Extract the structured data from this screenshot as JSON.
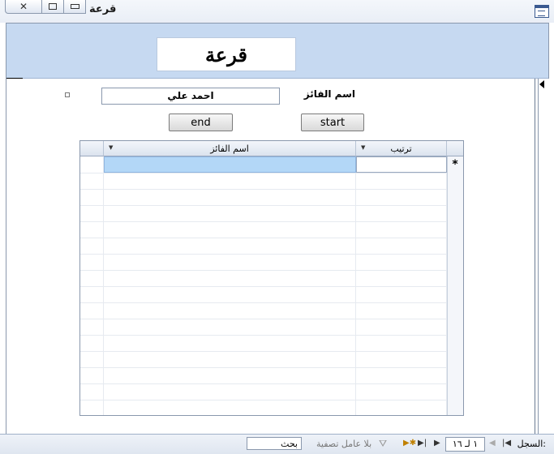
{
  "window": {
    "title": "قرعة"
  },
  "form": {
    "header_title": "قرعة",
    "winner_label": "اسم الفائز",
    "winner_value": "احمد علي",
    "end_button": "end",
    "start_button": "start"
  },
  "datasheet": {
    "columns": [
      {
        "label": "اسم الفائز"
      },
      {
        "label": "ترتيب"
      }
    ],
    "new_row_marker": "*"
  },
  "statusbar": {
    "record_label": "السجل:",
    "record_position": "١ لـ ١٦",
    "filter_label": "بلا عامل تصفية",
    "search_placeholder": "بحث"
  },
  "colors": {
    "header_band": "#c6d9f1",
    "selected_cell": "#b3d7f7",
    "border": "#8a98ad"
  }
}
